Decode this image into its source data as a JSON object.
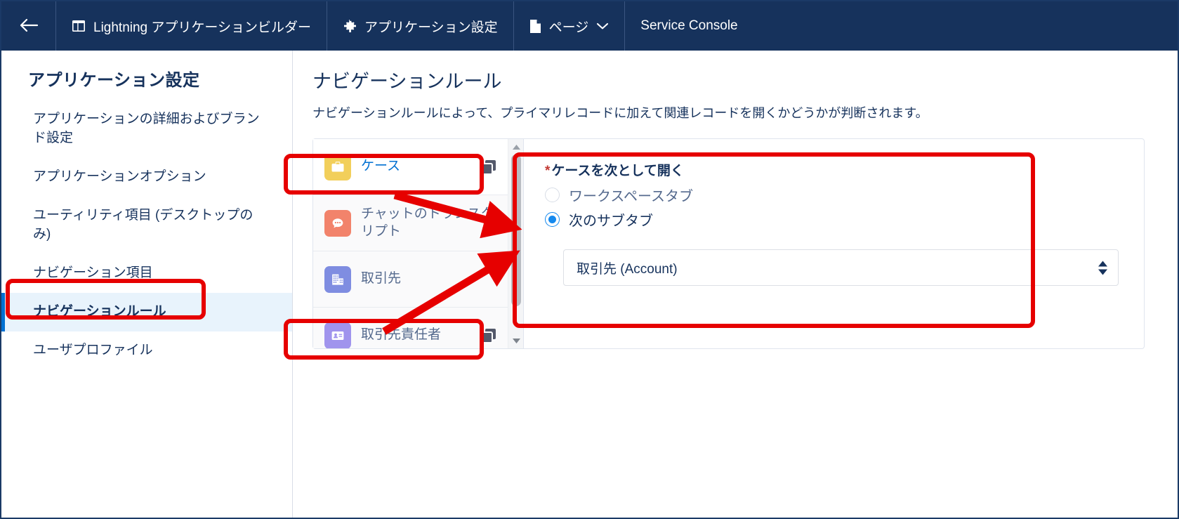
{
  "topbar": {
    "back_icon": "back-arrow-icon",
    "items": [
      {
        "icon": "app-builder-layout-icon",
        "label": "Lightning アプリケーションビルダー",
        "has_chevron": false
      },
      {
        "icon": "gear-icon",
        "label": "アプリケーション設定",
        "has_chevron": false
      },
      {
        "icon": "page-document-icon",
        "label": "ページ",
        "has_chevron": true
      },
      {
        "icon": "",
        "label": "Service Console",
        "has_chevron": false
      }
    ],
    "bg_color": "#16325c"
  },
  "sidebar": {
    "title": "アプリケーション設定",
    "items": [
      {
        "label": "アプリケーションの詳細およびブランド設定",
        "selected": false
      },
      {
        "label": "アプリケーションオプション",
        "selected": false
      },
      {
        "label": "ユーティリティ項目 (デスクトップのみ)",
        "selected": false
      },
      {
        "label": "ナビゲーション項目",
        "selected": false
      },
      {
        "label": "ナビゲーションルール",
        "selected": true
      },
      {
        "label": "ユーザプロファイル",
        "selected": false
      }
    ],
    "selected_bg": "#e8f3fc",
    "accent_color": "#0070d2"
  },
  "main": {
    "title": "ナビゲーションルール",
    "description": "ナビゲーションルールによって、プライマリレコードに加えて関連レコードを開くかどうかが判断されます。"
  },
  "object_list": {
    "items": [
      {
        "label": "ケース",
        "icon": "briefcase-case-icon",
        "icon_color": "#F2CF5B",
        "active": true,
        "has_duplicate_icon": true
      },
      {
        "label": "チャットのトランスクリプト",
        "icon": "chat-transcript-icon",
        "icon_color": "#F2836B",
        "active": false,
        "has_duplicate_icon": false
      },
      {
        "label": "取引先",
        "icon": "account-building-icon",
        "icon_color": "#7F8DE1",
        "active": false,
        "has_duplicate_icon": false
      },
      {
        "label": "取引先責任者",
        "icon": "contact-card-icon",
        "icon_color": "#A094ED",
        "active": false,
        "has_duplicate_icon": true
      }
    ],
    "scrollbar": {
      "up_icon": "scroll-up-arrow-icon",
      "down_icon": "scroll-down-arrow-icon"
    }
  },
  "config": {
    "required_marker": "*",
    "label": "ケースを次として開く",
    "radios": [
      {
        "label": "ワークスペースタブ",
        "checked": false
      },
      {
        "label": "次のサブタブ",
        "checked": true
      }
    ],
    "select": {
      "value": "取引先 (Account)",
      "stepper_icon": "updown-stepper-icon"
    },
    "accent_color": "#1589ee"
  },
  "annotations": {
    "color": "#e60000",
    "boxes": [
      "sidebar-nav-rule",
      "object-case",
      "object-contact",
      "config-pane"
    ],
    "arrows": [
      "case-to-config",
      "contact-to-config"
    ]
  }
}
